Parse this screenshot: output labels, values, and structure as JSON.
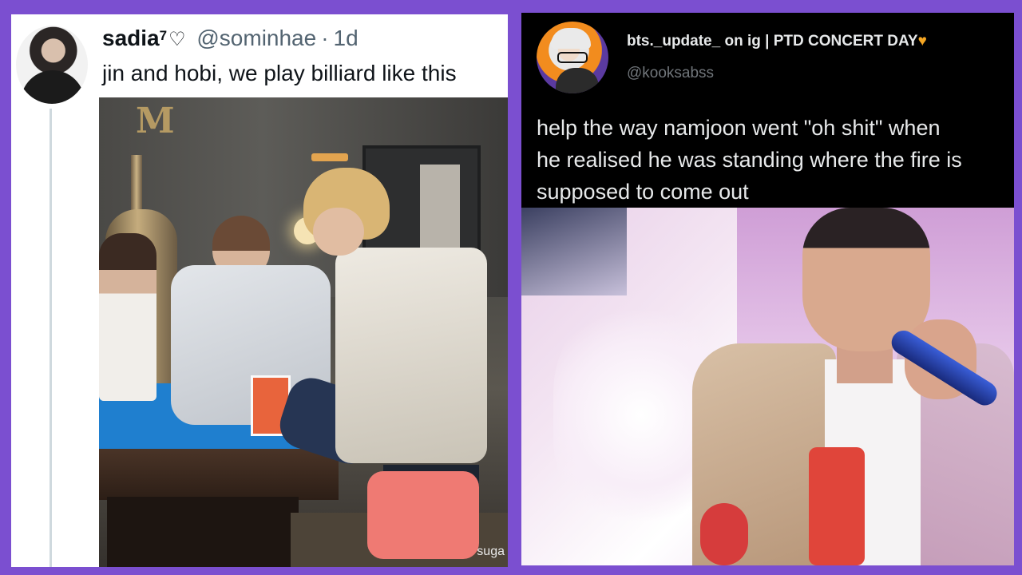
{
  "left_tweet": {
    "display_name": "sadia",
    "name_superscript": "7",
    "name_icon": "heart-outline-icon",
    "handle": "@sominhae",
    "separator": "·",
    "time": "1d",
    "text": "jin and hobi, we play billiard like this",
    "media_watermark": "suga"
  },
  "right_tweet": {
    "display_name": "bts._update_ on ig | PTD CONCERT DAY",
    "name_icon": "orange-heart-icon",
    "name_icon_glyph": "♥",
    "handle": "@kooksabss",
    "text_lines": [
      "help the way namjoon went \"oh shit\" when",
      "he realised he was standing where the fire is",
      "supposed to come out"
    ]
  },
  "colors": {
    "background": "#7b4fd0",
    "left_panel": "#ffffff",
    "right_panel": "#000000",
    "heart_orange": "#f5a623"
  }
}
